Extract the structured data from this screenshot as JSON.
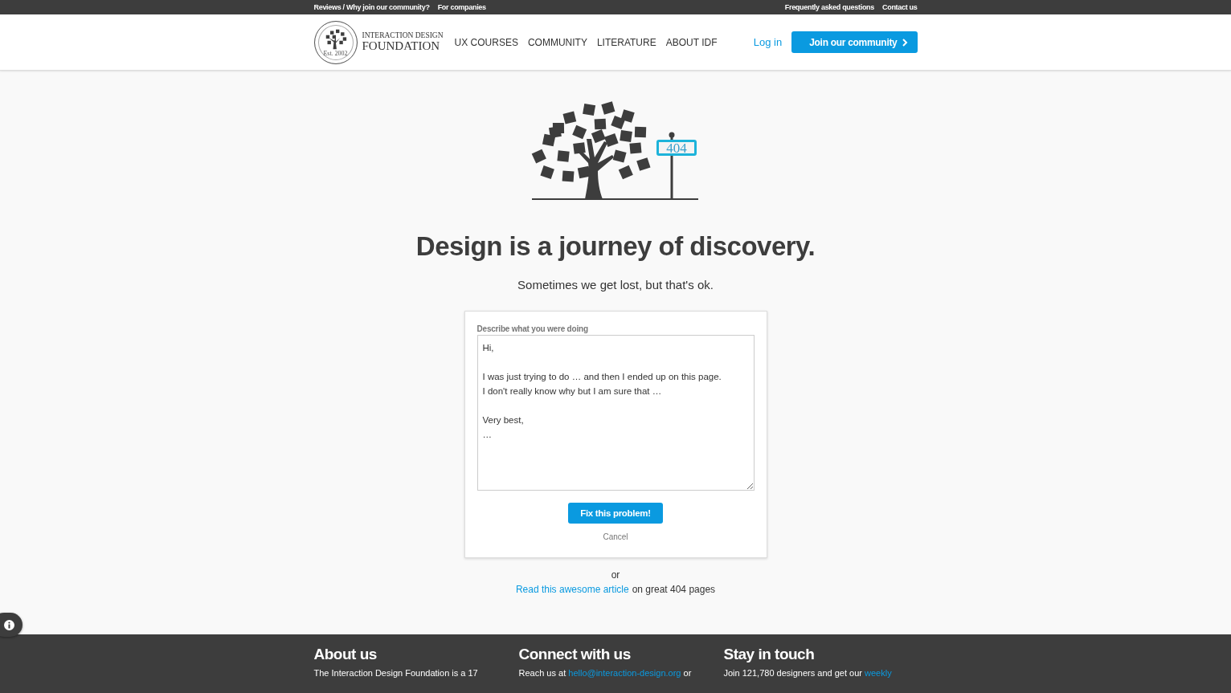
{
  "top_bar": {
    "left_links": [
      "Reviews / Why join our community?",
      "For companies"
    ],
    "right_links": [
      "Frequently asked questions",
      "Contact us"
    ]
  },
  "header": {
    "logo": {
      "line1": "INTERACTION DESIGN",
      "line2": "FOUNDATION",
      "est": "Est. 2002"
    },
    "nav": [
      "UX COURSES",
      "COMMUNITY",
      "LITERATURE",
      "ABOUT IDF"
    ],
    "login": "Log in",
    "join": "Join our community"
  },
  "hero": {
    "sign": "404",
    "title": "Design is a journey of discovery.",
    "subtitle": "Sometimes we get lost, but that's ok."
  },
  "form": {
    "label": "Describe what you were doing",
    "value": "Hi,\n\nI was just trying to do … and then I ended up on this page.\nI don't really know why but I am sure that …\n\nVery best,\n…",
    "submit": "Fix this problem!",
    "cancel": "Cancel"
  },
  "alt": {
    "or": "or",
    "link": "Read this awesome article",
    "rest": "on great 404 pages"
  },
  "footer": {
    "columns": [
      {
        "title": "About us",
        "text": "The Interaction Design Foundation is a 17"
      },
      {
        "title": "Connect with us",
        "text": "Reach us at",
        "link": "hello@interaction-design.org",
        "after": "or"
      },
      {
        "title": "Stay in touch",
        "text": "Join 121,780 designers and get our",
        "link": "weekly"
      }
    ]
  }
}
